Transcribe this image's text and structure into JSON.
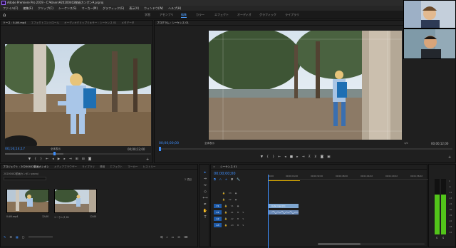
{
  "title_bar": {
    "title": "Adobe Premiere Pro 2019 - C:¥Users¥20200402動画カンポン¥.prproj"
  },
  "menu": [
    "ファイル(F)",
    "編集(E)",
    "クリップ(C)",
    "シーケンス(S)",
    "マーカー(M)",
    "グラフィック(G)",
    "表示(V)",
    "ウィンドウ(W)",
    "ヘルプ(H)"
  ],
  "workspaces": [
    {
      "label": "学習",
      "active": false
    },
    {
      "label": "アセンブリ",
      "active": false
    },
    {
      "label": "編集",
      "active": true
    },
    {
      "label": "カラー",
      "active": false
    },
    {
      "label": "エフェクト",
      "active": false
    },
    {
      "label": "オーディオ",
      "active": false
    },
    {
      "label": "グラフィック",
      "active": false
    },
    {
      "label": "ライブラリ",
      "active": false
    }
  ],
  "source_panel": {
    "tabs": [
      "ソース : 0.AVI.mp4",
      "エフェクトコントロール",
      "オーディオクリップミキサー : シーケンス 01",
      "メタデータ"
    ],
    "timecode": "00;16;14;17",
    "fit": "全体表示",
    "duration": "00;00;12;00"
  },
  "program_panel": {
    "tabs": [
      "プログラム : シーケンス 01"
    ],
    "timecode": "00;00;00;00",
    "fit": "全体表示",
    "duration": "00;00;12;00",
    "quality": "1/2"
  },
  "project_panel": {
    "tabs": [
      "プロジェクト : 20200402動画カンポン",
      "メディアブラウザー",
      "ライブラリ",
      "情報",
      "エフェクト",
      "マーカー",
      "ヒストリー"
    ],
    "path": "20200402動画カンポン.prproj",
    "item_count": "2 項目",
    "items": [
      {
        "name": "0.AVI.mp4",
        "duration": "12;00"
      },
      {
        "name": "シーケンス 01",
        "duration": "12;00"
      }
    ]
  },
  "timeline": {
    "tab": "シーケンス 01",
    "timecode": "00;00;00;00",
    "ruler": [
      "00;00",
      "00;00;16;00",
      "00;00;32;00",
      "00;00;48;00",
      "00;01;04;02",
      "00;01;20;02",
      "00;01;36;02"
    ],
    "video_tracks": [
      "V3",
      "V2",
      "V1"
    ],
    "audio_tracks": [
      "A1",
      "A2",
      "A3"
    ],
    "clips": [
      {
        "track": "V1",
        "label": "0.AVI.mp4 [V]"
      },
      {
        "track": "A1",
        "label": ""
      }
    ]
  },
  "audio_meter": {
    "scale": [
      "0",
      "-6",
      "-12",
      "-18",
      "-24",
      "-30",
      "-36",
      "-42",
      "-48",
      "-54"
    ],
    "level_left": 0.72,
    "level_right": 0.72,
    "labels": [
      "S",
      "S"
    ]
  },
  "colors": {
    "accent": "#3d8fff",
    "active_tab": "#4d9fff",
    "target": "#1e5aa8",
    "clip_video": "#7fa6cf",
    "clip_audio": "#6b8bb8",
    "meter": "#52c41a"
  },
  "icons": [
    "home-icon",
    "play-icon",
    "step-back-icon",
    "step-forward-icon",
    "mark-in-icon",
    "mark-out-icon",
    "insert-icon",
    "overwrite-icon",
    "export-frame-icon",
    "wrench-icon",
    "add-icon",
    "selection-tool-icon",
    "razor-tool-icon",
    "hand-tool-icon",
    "type-tool-icon"
  ]
}
